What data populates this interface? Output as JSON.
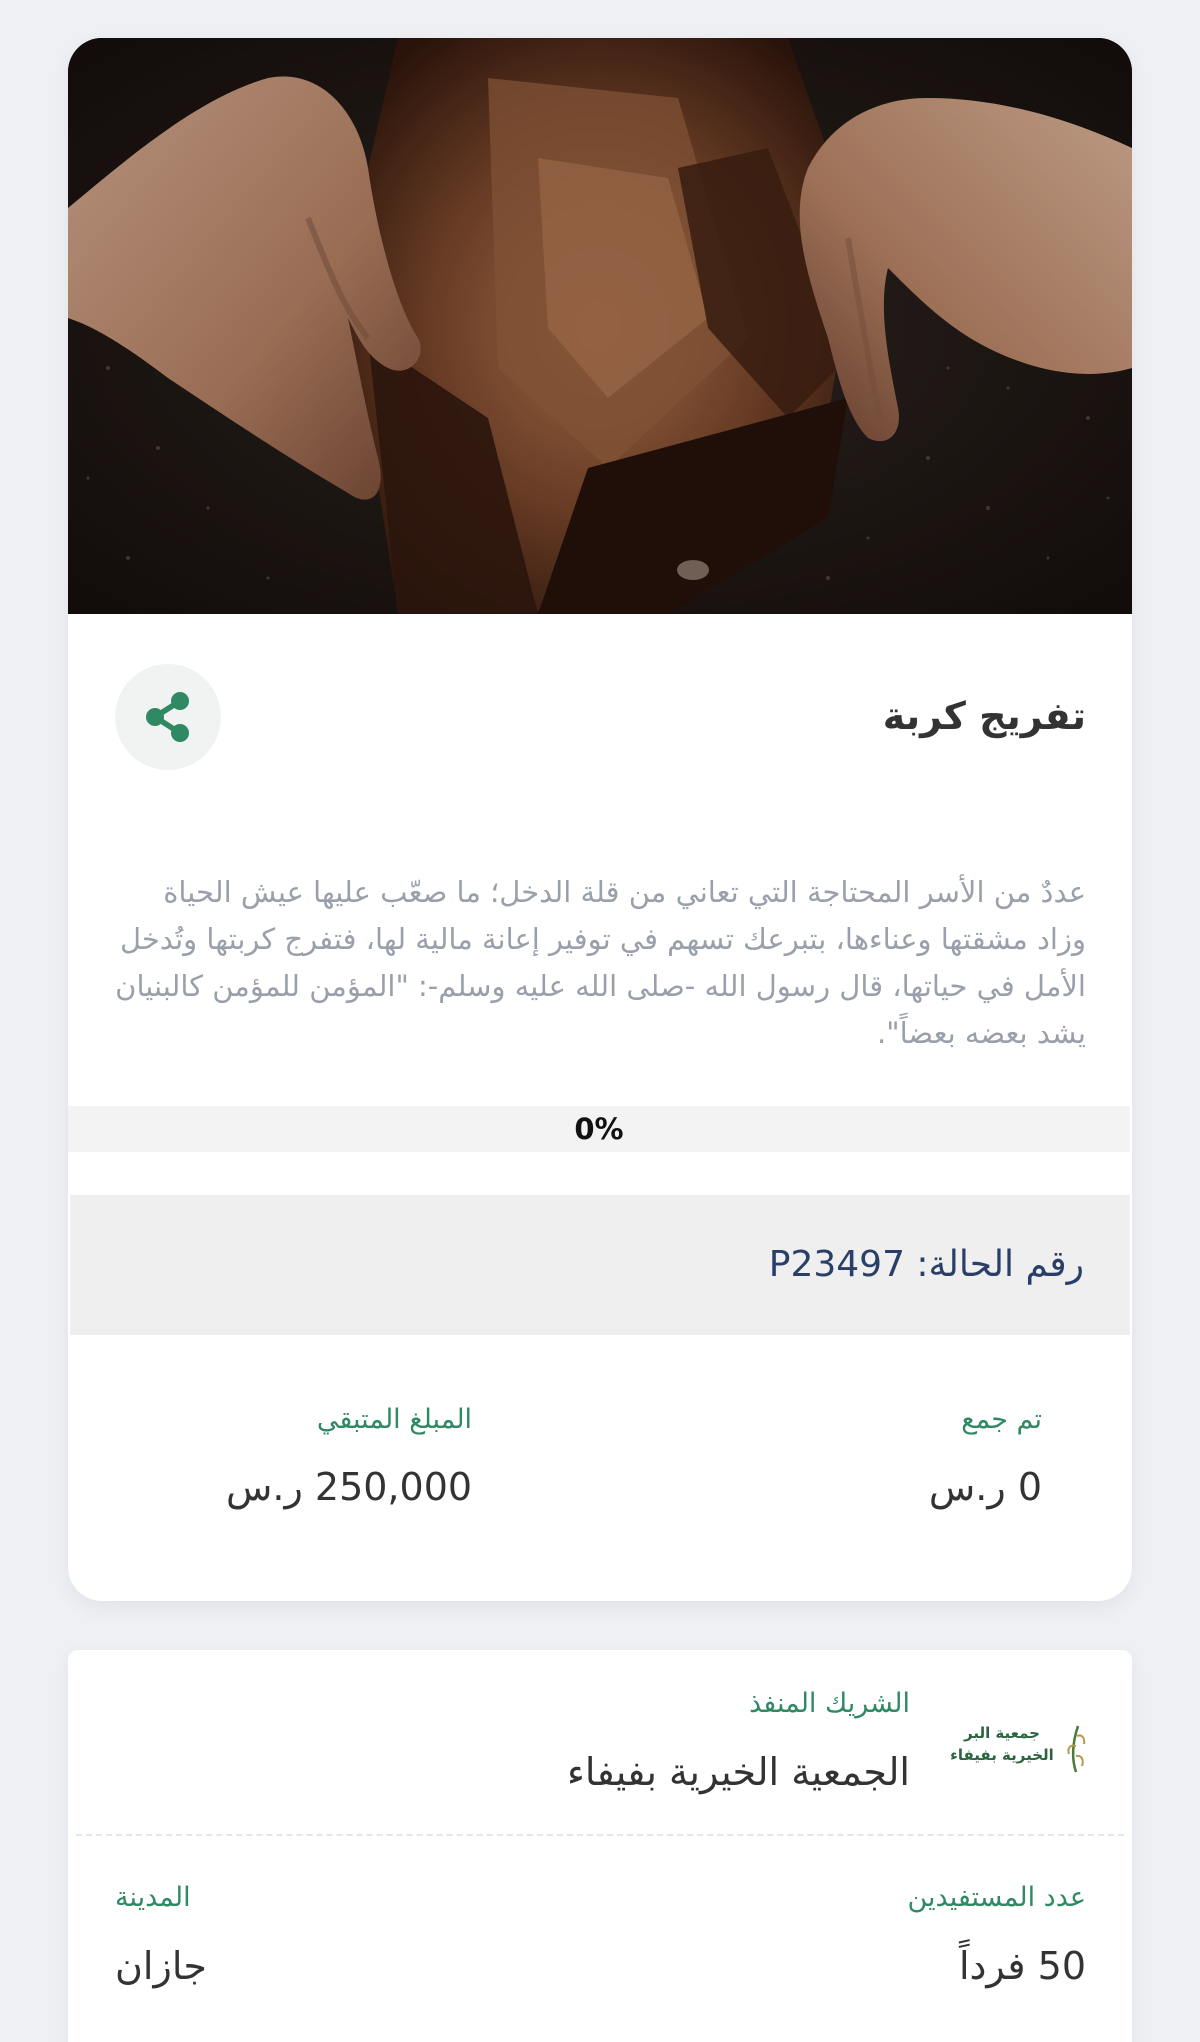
{
  "campaign": {
    "image_alt": "hands opening an empty leather wallet",
    "title": "تفريج كربة",
    "share_icon": "share-icon",
    "description": "عددٌ من الأسر المحتاجة التي تعاني من قلة الدخل؛ ما صعّب عليها عيش الحياة وزاد مشقتها وعناءها، بتبرعك تسهم في توفير إعانة مالية لها، فتفرج كربتها وتُدخل الأمل في حياتها، قال رسول الله -صلى الله عليه وسلم-: \"المؤمن للمؤمن كالبنيان يشد بعضه بعضاً\".",
    "progress": {
      "percent": 0,
      "label": "0%"
    },
    "case_number": "رقم الحالة: P23497",
    "collected": {
      "label": "تم جمع",
      "value": "0 ر.س"
    },
    "remaining": {
      "label": "المبلغ المتبقي",
      "value": "250,000 ر.س"
    }
  },
  "partner": {
    "logo_text": "جمعية البر الخيرية بفيفاء",
    "label": "الشريك المنفذ",
    "name": "الجمعية الخيرية بفيفاء"
  },
  "details": {
    "beneficiaries_label": "عدد المستفيدين",
    "beneficiaries_value": "50 فرداً",
    "city_label": "المدينة",
    "city_value": "جازان"
  },
  "colors": {
    "accent": "#2f8a63",
    "title": "#333333",
    "description": "#9aa0ab",
    "case_number": "#2a3f67",
    "page_background": "#eef0f4"
  }
}
